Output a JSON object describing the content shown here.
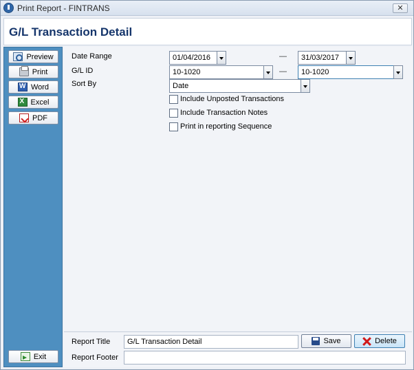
{
  "window": {
    "title": "Print Report - FINTRANS",
    "close_glyph": "✕"
  },
  "report": {
    "heading": "G/L Transaction Detail"
  },
  "sidebar": {
    "preview": "Preview",
    "print": "Print",
    "word": "Word",
    "excel": "Excel",
    "pdf": "PDF",
    "exit": "Exit"
  },
  "form": {
    "date_range_label": "Date Range",
    "date_from": "01/04/2016",
    "date_to": "31/03/2017",
    "gl_id_label": "G/L ID",
    "gl_from": "10-1020",
    "gl_to": "10-1020",
    "sort_by_label": "Sort By",
    "sort_by_value": "Date",
    "range_separator": "—",
    "opt_unposted": "Include Unposted Transactions",
    "opt_notes": "Include Transaction Notes",
    "opt_sequence": "Print in reporting Sequence"
  },
  "footer": {
    "report_title_label": "Report Title",
    "report_title_value": "G/L Transaction Detail",
    "report_footer_label": "Report Footer",
    "report_footer_value": "",
    "save": "Save",
    "delete": "Delete"
  }
}
